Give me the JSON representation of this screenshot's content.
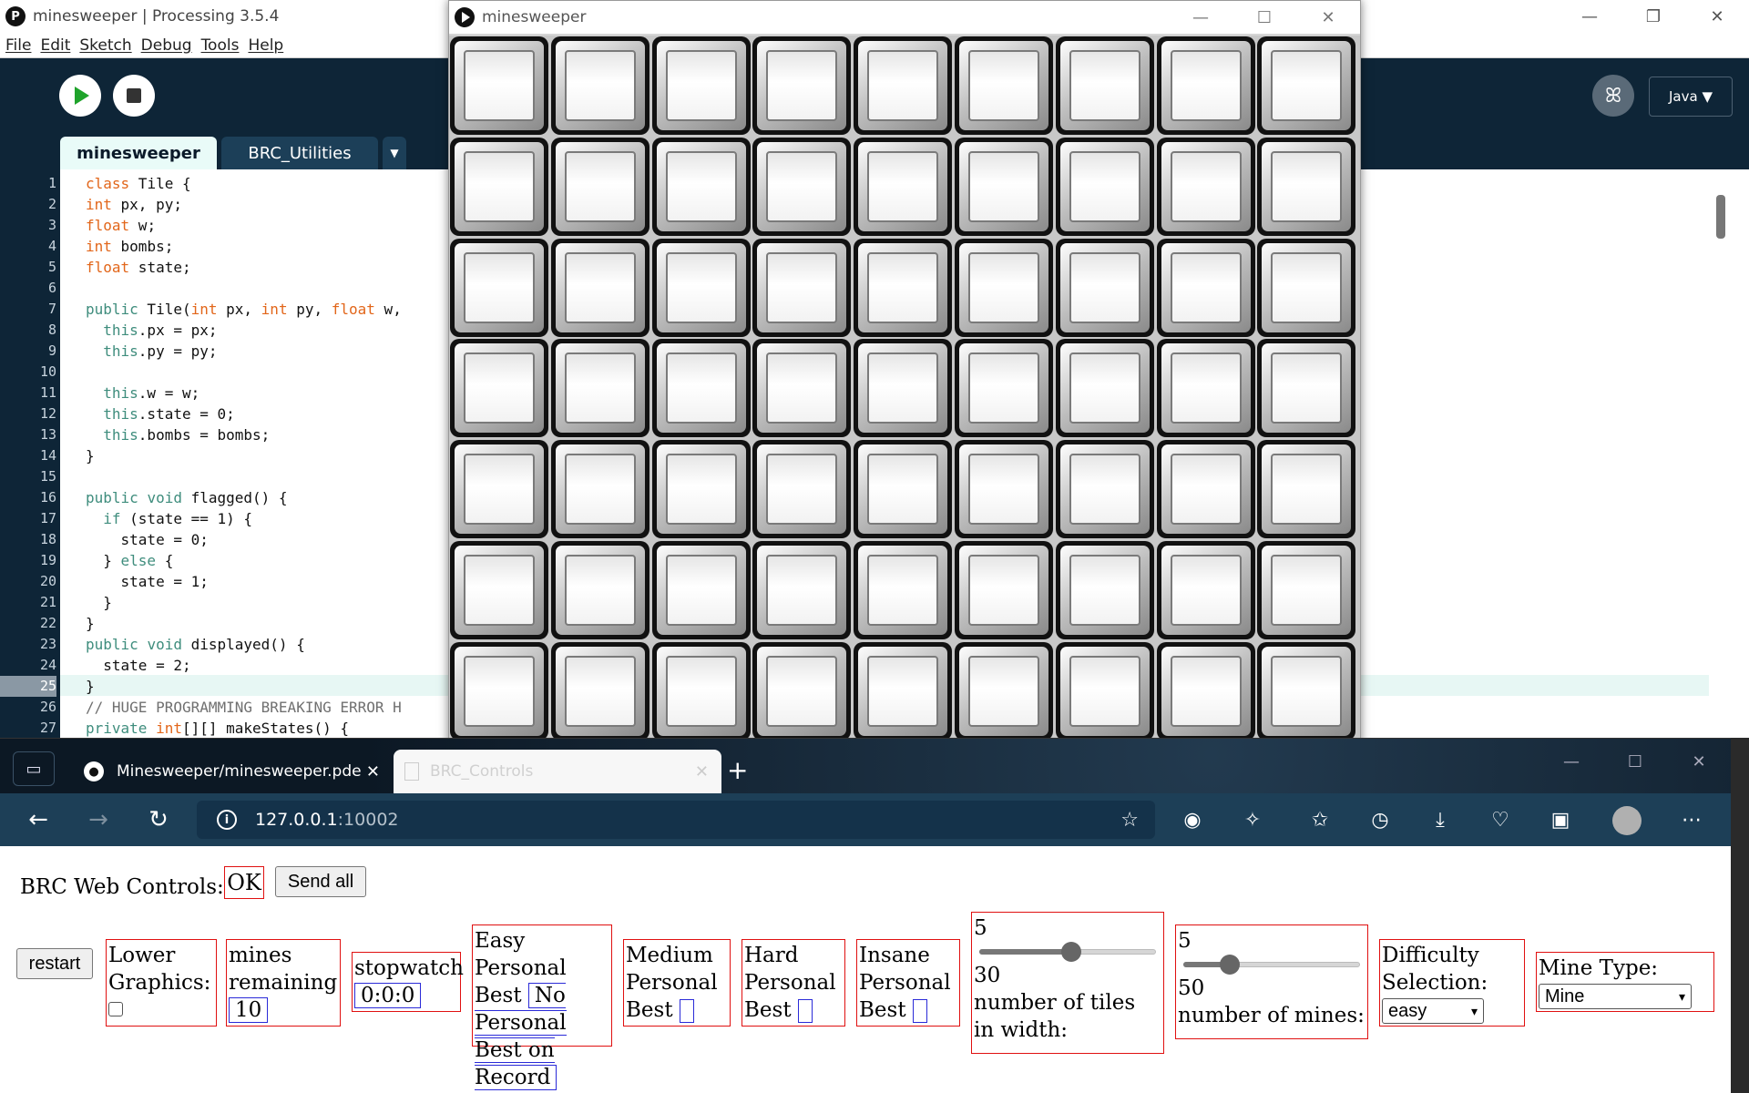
{
  "ide": {
    "logo_letter": "P",
    "title": "minesweeper | Processing 3.5.4",
    "menu": [
      "File",
      "Edit",
      "Sketch",
      "Debug",
      "Tools",
      "Help"
    ],
    "mode_label": "Java ▼",
    "tabs": [
      "minesweeper",
      "BRC_Utilities"
    ],
    "tab_more": "▼",
    "current_line": 25,
    "code": [
      [
        [
          "ty",
          "class"
        ],
        [
          "",
          " Tile {"
        ]
      ],
      [
        [
          "ty",
          "int"
        ],
        [
          "",
          " px, py;"
        ]
      ],
      [
        [
          "ty",
          "float"
        ],
        [
          "",
          " w;"
        ]
      ],
      [
        [
          "ty",
          "int"
        ],
        [
          "",
          " bombs;"
        ]
      ],
      [
        [
          "ty",
          "float"
        ],
        [
          "",
          " state;"
        ]
      ],
      [],
      [
        [
          "kw",
          "public"
        ],
        [
          "",
          " Tile("
        ],
        [
          "ty",
          "int"
        ],
        [
          "",
          " px, "
        ],
        [
          "ty",
          "int"
        ],
        [
          "",
          " py, "
        ],
        [
          "ty",
          "float"
        ],
        [
          "",
          " w,"
        ]
      ],
      [
        [
          "",
          "  "
        ],
        [
          "kw",
          "this"
        ],
        [
          "",
          ".px = px;"
        ]
      ],
      [
        [
          "",
          "  "
        ],
        [
          "kw",
          "this"
        ],
        [
          "",
          ".py = py;"
        ]
      ],
      [],
      [
        [
          "",
          "  "
        ],
        [
          "kw",
          "this"
        ],
        [
          "",
          ".w = w;"
        ]
      ],
      [
        [
          "",
          "  "
        ],
        [
          "kw",
          "this"
        ],
        [
          "",
          ".state = 0;"
        ]
      ],
      [
        [
          "",
          "  "
        ],
        [
          "kw",
          "this"
        ],
        [
          "",
          ".bombs = bombs;"
        ]
      ],
      [
        [
          "",
          "}"
        ]
      ],
      [],
      [
        [
          "kw",
          "public"
        ],
        [
          "",
          " "
        ],
        [
          "kw",
          "void"
        ],
        [
          "",
          " flagged() {"
        ]
      ],
      [
        [
          "",
          "  "
        ],
        [
          "kw",
          "if"
        ],
        [
          "",
          " (state == 1) {"
        ]
      ],
      [
        [
          "",
          "    state = 0;"
        ]
      ],
      [
        [
          "",
          "  } "
        ],
        [
          "kw",
          "else"
        ],
        [
          "",
          " {"
        ]
      ],
      [
        [
          "",
          "    state = 1;"
        ]
      ],
      [
        [
          "",
          "  }"
        ]
      ],
      [
        [
          "",
          "}"
        ]
      ],
      [
        [
          "kw",
          "public"
        ],
        [
          "",
          " "
        ],
        [
          "kw",
          "void"
        ],
        [
          "",
          " displayed() {"
        ]
      ],
      [
        [
          "",
          "  state = 2;"
        ]
      ],
      [
        [
          "",
          "}"
        ]
      ],
      [
        [
          "cm",
          "// HUGE PROGRAMMING BREAKING ERROR H"
        ]
      ],
      [
        [
          "kw",
          "private"
        ],
        [
          "",
          " "
        ],
        [
          "ty",
          "int"
        ],
        [
          "",
          "[][] makeStates() {"
        ]
      ]
    ]
  },
  "sketch": {
    "title": "minesweeper",
    "cols": 9,
    "rows": 7
  },
  "browser": {
    "tabs": [
      {
        "label": "Minesweeper/minesweeper.pde",
        "icon": "github-icon"
      },
      {
        "label": "BRC_Controls",
        "icon": "document-icon"
      }
    ],
    "url_host": "127.0.0.1",
    "url_port": ":10002"
  },
  "controls": {
    "title": "BRC Web Controls:",
    "status": "OK",
    "send_all": "Send all",
    "restart": "restart",
    "lower_graphics_label": "Lower Graphics:",
    "mines_remaining_label": "mines remaining",
    "mines_remaining_value": "10",
    "stopwatch_label": "stopwatch",
    "stopwatch_value": "0:0:0",
    "easy_pb_label": "Easy Personal Best",
    "easy_pb_value": "No Personal Best on Record",
    "medium_pb_label": "Medium Personal Best",
    "hard_pb_label": "Hard Personal Best",
    "insane_pb_label": "Insane Personal Best",
    "width_slider": {
      "min": "5",
      "max": "30",
      "value": 18,
      "range": [
        5,
        30
      ],
      "label": "number of tiles in width:"
    },
    "mines_slider": {
      "min": "5",
      "max": "50",
      "value": 16,
      "range": [
        5,
        50
      ],
      "label": "number of mines:"
    },
    "difficulty_label": "Difficulty Selection:",
    "difficulty_value": "easy",
    "mine_type_label": "Mine Type:",
    "mine_type_value": "Mine"
  }
}
